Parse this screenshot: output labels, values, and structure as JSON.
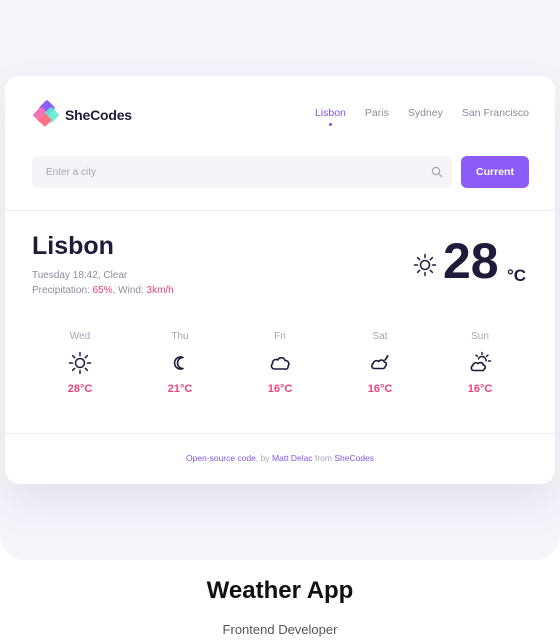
{
  "brand": {
    "name": "SheCodes"
  },
  "nav": [
    {
      "label": "Lisbon",
      "active": true
    },
    {
      "label": "Paris",
      "active": false
    },
    {
      "label": "Sydney",
      "active": false
    },
    {
      "label": "San Francisco",
      "active": false
    }
  ],
  "search": {
    "placeholder": "Enter a city",
    "button_label": "Current"
  },
  "current": {
    "city": "Lisbon",
    "description": "Tuesday 18:42, Clear",
    "precip_label": "Precipitation: ",
    "precip_value": "65%",
    "wind_label": ", Wind: ",
    "wind_value": "3km/h",
    "temperature": "28",
    "unit": "°C",
    "icon": "sun-icon"
  },
  "forecast": [
    {
      "day": "Wed",
      "temp": "28°C",
      "icon": "sun-icon"
    },
    {
      "day": "Thu",
      "temp": "21°C",
      "icon": "moon-icon"
    },
    {
      "day": "Fri",
      "temp": "16°C",
      "icon": "cloud-icon"
    },
    {
      "day": "Sat",
      "temp": "16°C",
      "icon": "rain-cloud-icon"
    },
    {
      "day": "Sun",
      "temp": "16°C",
      "icon": "sun-cloud-icon"
    }
  ],
  "footer": {
    "link1": "Open-source code",
    "text1": ", by ",
    "link2": "Matt Delac",
    "text2": " from ",
    "link3": "SheCodes"
  },
  "caption": {
    "title": "Weather App",
    "subtitle": "Frontend Developer"
  },
  "colors": {
    "accent": "#8b5cf6",
    "highlight": "#e8437a",
    "text": "#1f1c3b",
    "muted": "#8e8b9e"
  }
}
